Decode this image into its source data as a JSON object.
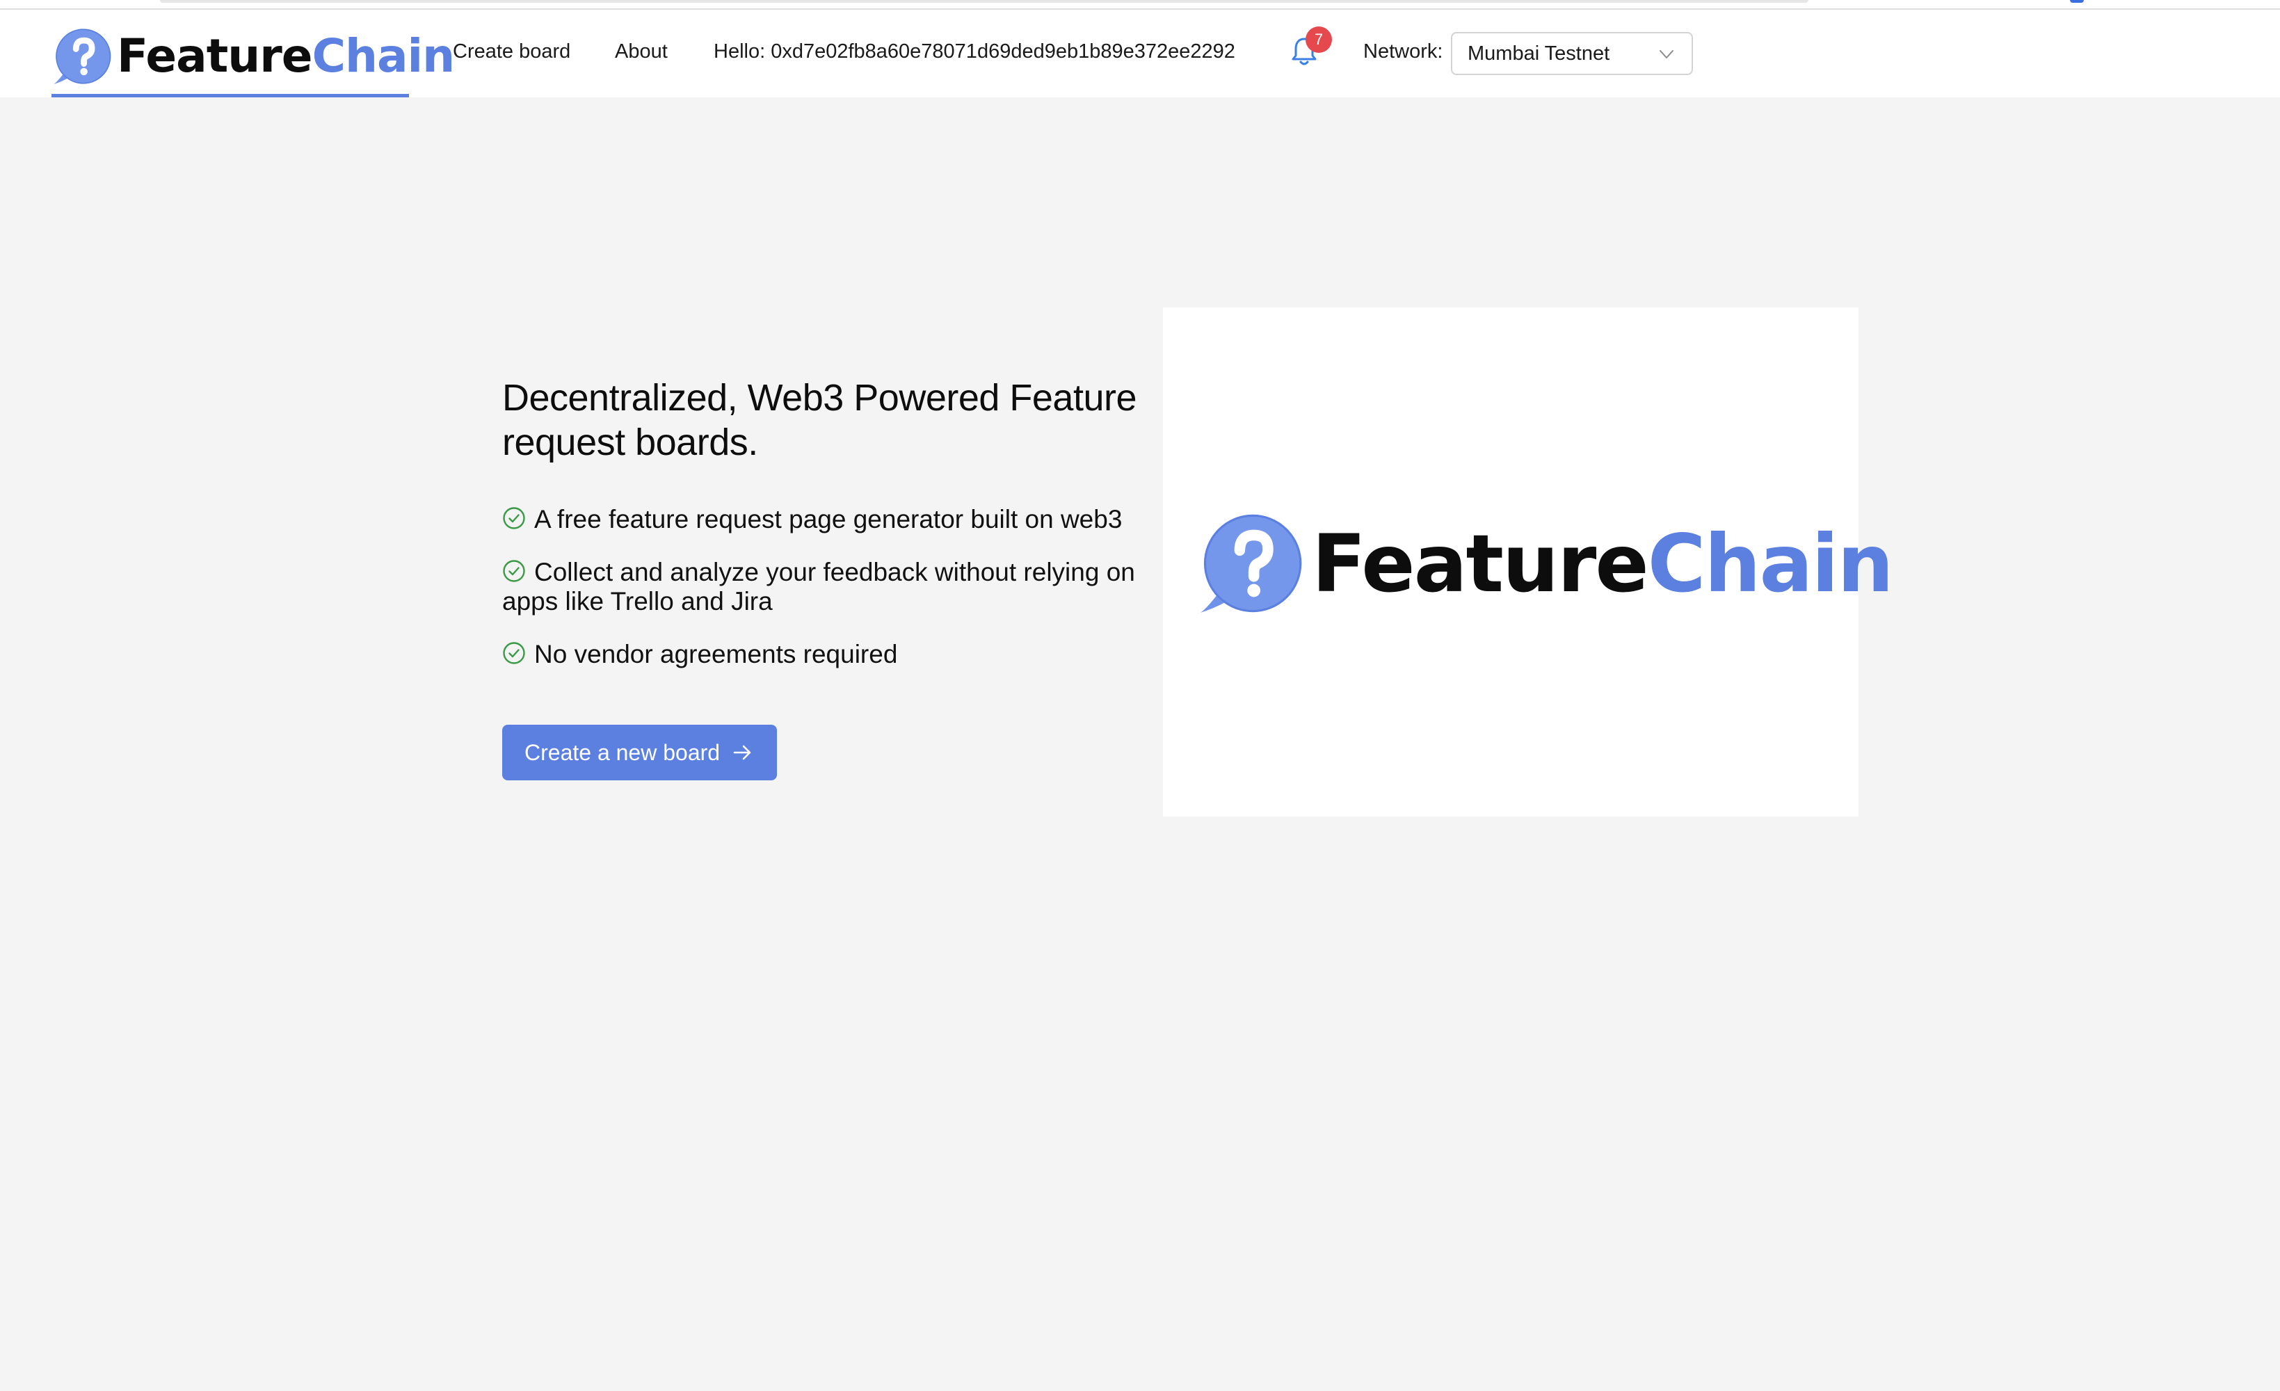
{
  "brand": {
    "name_part1": "Feature",
    "name_part2": "Chain",
    "accent_color": "#5b80e0"
  },
  "nav": {
    "create_board": "Create board",
    "about": "About",
    "hello": "Hello: 0xd7e02fb8a60e78071d69ded9eb1b89e372ee2292"
  },
  "notifications": {
    "count": "7",
    "icon": "bell-icon"
  },
  "network": {
    "label": "Network:",
    "selected": "Mumbai Testnet"
  },
  "hero": {
    "title": "Decentralized, Web3 Powered Feature request boards.",
    "features": [
      "A free feature request page generator built on web3",
      "Collect and analyze your feedback without relying on apps like Trello and Jira",
      "No vendor agreements required"
    ],
    "cta_label": "Create a new board",
    "check_color": "#3a9a46"
  }
}
